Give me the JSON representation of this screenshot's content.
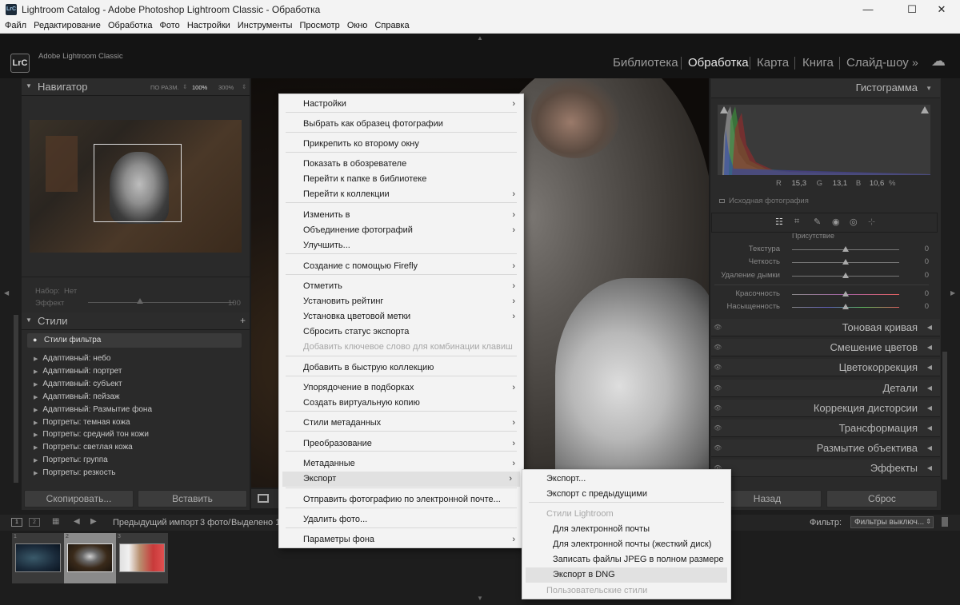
{
  "window": {
    "title": "Lightroom Catalog - Adobe Photoshop Lightroom Classic - Обработка",
    "app_badge": "LrC"
  },
  "menubar": [
    "Файл",
    "Редактирование",
    "Обработка",
    "Фото",
    "Настройки",
    "Инструменты",
    "Просмотр",
    "Окно",
    "Справка"
  ],
  "identity": {
    "app_name": "Adobe Lightroom Classic",
    "badge": "LrC"
  },
  "modules": [
    "Библиотека",
    "Обработка",
    "Карта",
    "Книга",
    "Слайд-шоу"
  ],
  "navigator": {
    "title": "Навигатор",
    "zoom_options": [
      "ПО РАЗМ.",
      "100%",
      "300%"
    ]
  },
  "preset_amount": {
    "set_label": "Набор:",
    "set_value": "Нет",
    "effect_label": "Эффект",
    "effect_value": "100"
  },
  "styles": {
    "title": "Стили",
    "filter_label": "Стили фильтра",
    "items": [
      "Адаптивный: небо",
      "Адаптивный: портрет",
      "Адаптивный: субъект",
      "Адаптивный: пейзаж",
      "Адаптивный: Размытие фона",
      "Портреты: темная кожа",
      "Портреты: средний тон кожи",
      "Портреты: светлая кожа",
      "Портреты: группа",
      "Портреты: резкость"
    ]
  },
  "left_buttons": {
    "copy": "Скопировать...",
    "paste": "Вставить"
  },
  "histogram": {
    "title": "Гистограмма",
    "r_label": "R",
    "r_value": "15,3",
    "g_label": "G",
    "g_value": "13,1",
    "b_label": "B",
    "b_value": "10,6",
    "percent": "%",
    "original_label": "Исходная фотография"
  },
  "presence": {
    "header": "Присутствие",
    "sliders": [
      {
        "name": "Текстура",
        "value": "0",
        "level": 0.5
      },
      {
        "name": "Четкость",
        "value": "0",
        "level": 0.5
      },
      {
        "name": "Удаление дымки",
        "value": "0",
        "level": 0.5
      },
      {
        "name": "Красочность",
        "value": "0",
        "level": 0.5
      },
      {
        "name": "Насыщенность",
        "value": "0",
        "level": 0.5
      }
    ]
  },
  "right_panels": [
    "Тоновая кривая",
    "Смешение цветов",
    "Цветокоррекция",
    "Детали",
    "Коррекция дисторсии",
    "Трансформация",
    "Размытие объектива",
    "Эффекты"
  ],
  "right_buttons": {
    "back": "Назад",
    "reset": "Сброс"
  },
  "filmstrip": {
    "page1": "1",
    "page2": "2",
    "source": "Предыдущий импорт",
    "count": "3 фото/",
    "selected": "Выделено 1/",
    "filter_label": "Фильтр:",
    "filter_value": "Фильтры выключ...",
    "thumb_numbers": [
      "1",
      "2",
      "3"
    ]
  },
  "context_menu": {
    "items": [
      {
        "label": "Настройки",
        "submenu": true
      },
      {
        "label": "Выбрать как образец фотографии"
      },
      {
        "label": "Прикрепить ко второму окну"
      },
      {
        "label": "Показать в обозревателе"
      },
      {
        "label": "Перейти к папке в библиотеке"
      },
      {
        "label": "Перейти к коллекции",
        "submenu": true
      },
      {
        "label": "Изменить в",
        "submenu": true
      },
      {
        "label": "Объединение фотографий",
        "submenu": true
      },
      {
        "label": "Улучшить..."
      },
      {
        "label": "Создание с помощью Firefly",
        "submenu": true
      },
      {
        "label": "Отметить",
        "submenu": true
      },
      {
        "label": "Установить рейтинг",
        "submenu": true
      },
      {
        "label": "Установка цветовой метки",
        "submenu": true
      },
      {
        "label": "Сбросить статус экспорта"
      },
      {
        "label": "Добавить ключевое слово для комбинации клавиш",
        "disabled": true
      },
      {
        "label": "Добавить в быструю коллекцию"
      },
      {
        "label": "Упорядочение в подборках",
        "submenu": true
      },
      {
        "label": "Создать виртуальную копию"
      },
      {
        "label": "Стили метаданных",
        "submenu": true
      },
      {
        "label": "Преобразование",
        "submenu": true
      },
      {
        "label": "Метаданные",
        "submenu": true
      },
      {
        "label": "Экспорт",
        "submenu": true,
        "highlighted": true
      },
      {
        "label": "Отправить фотографию по электронной почте..."
      },
      {
        "label": "Удалить фото..."
      },
      {
        "label": "Параметры фона",
        "submenu": true
      }
    ]
  },
  "export_submenu": {
    "items": [
      {
        "label": "Экспорт..."
      },
      {
        "label": "Экспорт с предыдущими"
      },
      {
        "label": "Стили Lightroom",
        "disabled": true,
        "header": true
      },
      {
        "label": "Для электронной почты"
      },
      {
        "label": "Для электронной почты (жесткий диск)"
      },
      {
        "label": "Записать файлы JPEG в полном размере"
      },
      {
        "label": "Экспорт в DNG",
        "highlighted": true
      },
      {
        "label": "Пользовательские стили",
        "disabled": true,
        "header": true
      }
    ]
  },
  "colors": {
    "accent": "#f3f3f3",
    "panel": "#2a2a2a",
    "menu_bg": "#f3f3f3",
    "highlight": "#e1e1e1"
  },
  "icons": [
    "minimize-icon",
    "maximize-icon",
    "close-icon",
    "cloud-icon",
    "chevron-right-icon",
    "triangle-down-icon",
    "eye-icon"
  ]
}
